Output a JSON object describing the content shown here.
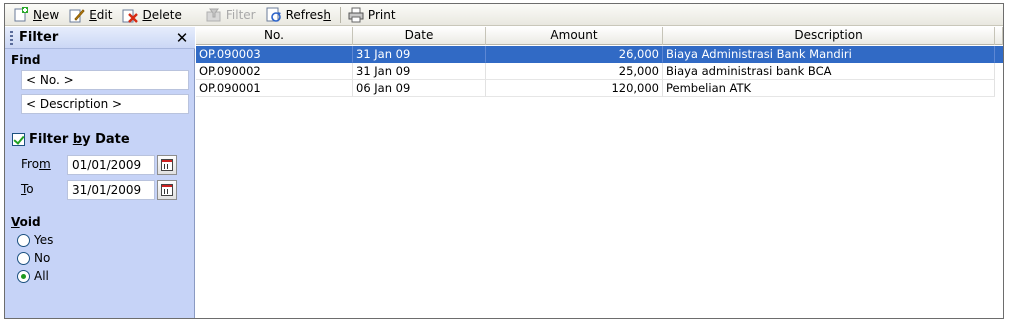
{
  "toolbar": {
    "new": {
      "pre": "",
      "key": "N",
      "post": "ew",
      "icon": "new-icon"
    },
    "edit": {
      "pre": "",
      "key": "E",
      "post": "dit",
      "icon": "edit-icon"
    },
    "delete": {
      "pre": "",
      "key": "D",
      "post": "elete",
      "icon": "delete-icon"
    },
    "filter": {
      "label": "Filter",
      "icon": "filter-icon"
    },
    "refresh": {
      "pre": "Refres",
      "key": "h",
      "post": "",
      "icon": "refresh-icon"
    },
    "print": {
      "label": "Print",
      "icon": "printer-icon"
    }
  },
  "filter_panel": {
    "title": "Filter",
    "find_label": "Find",
    "no_placeholder": "< No. >",
    "description_placeholder": "< Description >",
    "filter_by_date": {
      "pre": "Filter ",
      "key": "b",
      "post": "y Date",
      "checked": true
    },
    "from": {
      "pre": "Fro",
      "key": "m",
      "post": "",
      "value": "01/01/2009"
    },
    "to": {
      "pre": "",
      "key": "T",
      "post": "o",
      "value": "31/01/2009"
    },
    "void": {
      "label_key": "V",
      "label_post": "oid",
      "options": [
        "Yes",
        "No",
        "All"
      ],
      "selected": "All"
    }
  },
  "grid": {
    "columns": [
      "No.",
      "Date",
      "Amount",
      "Description"
    ],
    "rows": [
      {
        "no": "OP.090003",
        "date": "31 Jan 09",
        "amount": "26,000",
        "description": "Biaya Administrasi Bank Mandiri",
        "selected": true
      },
      {
        "no": "OP.090002",
        "date": "31 Jan 09",
        "amount": "25,000",
        "description": "Biaya administrasi bank BCA",
        "selected": false
      },
      {
        "no": "OP.090001",
        "date": "06 Jan 09",
        "amount": "120,000",
        "description": "Pembelian ATK",
        "selected": false
      }
    ]
  },
  "colors": {
    "selection": "#316ac5",
    "panel_bg": "#c6d3f7"
  }
}
